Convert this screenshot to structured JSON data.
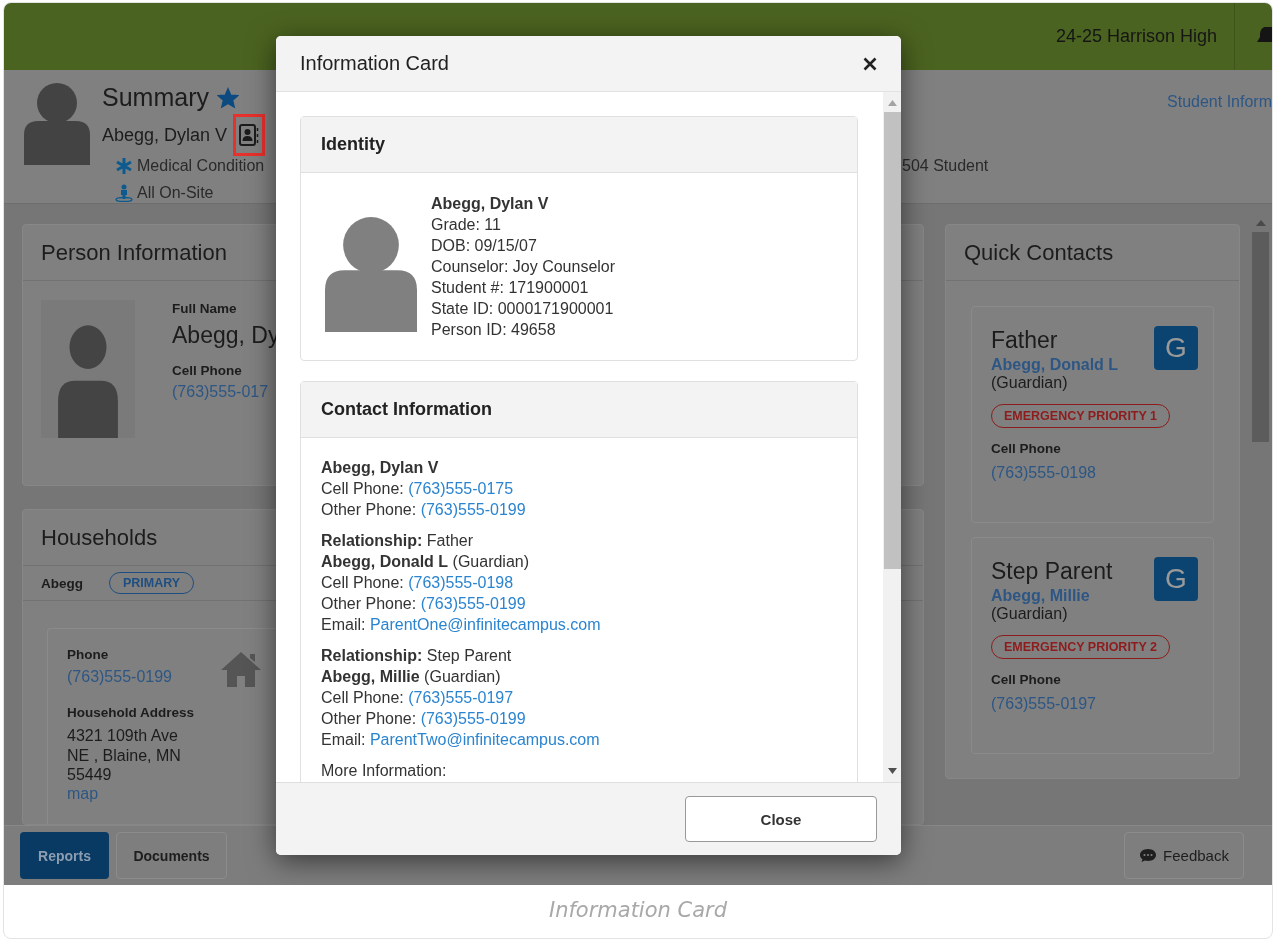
{
  "top_bar": {
    "school": "24-25 Harrison High"
  },
  "header": {
    "title": "Summary",
    "favorite": true,
    "student_name": "Abegg, Dylan V",
    "flags": [
      {
        "kind": "medical",
        "label": "Medical Condition"
      },
      {
        "kind": "plain",
        "label": "504 Student"
      }
    ],
    "location": "All On-Site",
    "link": "Student Inform"
  },
  "person_information": {
    "title": "Person Information",
    "fields": [
      {
        "label": "Full Name",
        "value": "Abegg, Dy",
        "kind": "large"
      },
      {
        "label": "Cell Phone",
        "value": "(763)555-017",
        "kind": "link"
      }
    ]
  },
  "households": {
    "title": "Households",
    "household": "Abegg",
    "badge": "PRIMARY",
    "phone_label": "Phone",
    "phone": "(763)555-0199",
    "address_label": "Household Address",
    "address": "4321 109th Ave NE , Blaine, MN 55449",
    "map_link": "map"
  },
  "quick_contacts": {
    "title": "Quick Contacts",
    "contacts": [
      {
        "relationship": "Father",
        "name": "Abegg, Donald L",
        "role": "(Guardian)",
        "badge": "G",
        "priority": "EMERGENCY PRIORITY 1",
        "phone_label": "Cell Phone",
        "phone": "(763)555-0198"
      },
      {
        "relationship": "Step Parent",
        "name": "Abegg, Millie",
        "role": "(Guardian)",
        "badge": "G",
        "priority": "EMERGENCY PRIORITY 2",
        "phone_label": "Cell Phone",
        "phone": "(763)555-0197"
      }
    ]
  },
  "bottom_bar": {
    "buttons": [
      {
        "label": "Reports",
        "kind": "primary"
      },
      {
        "label": "Documents",
        "kind": "default"
      }
    ],
    "feedback": "Feedback"
  },
  "modal": {
    "title": "Information Card",
    "identity": {
      "title": "Identity",
      "name": "Abegg, Dylan V",
      "lines": [
        "Grade: 11",
        "DOB: 09/15/07",
        "Counselor: Joy Counselor",
        "Student #: 171900001",
        "State ID: 0000171900001",
        "Person ID: 49658"
      ]
    },
    "contact": {
      "title": "Contact Information",
      "groups": [
        [
          {
            "kind": "name",
            "text": "Abegg, Dylan V"
          },
          {
            "kind": "link",
            "label": "Cell Phone:",
            "value": "(763)555-0175"
          },
          {
            "kind": "link",
            "label": "Other Phone:",
            "value": "(763)555-0199"
          }
        ],
        [
          {
            "kind": "rich",
            "text": "**Relationship:** Father"
          },
          {
            "kind": "rich",
            "text": "**Abegg, Donald L** (Guardian)"
          },
          {
            "kind": "link",
            "label": "Cell Phone:",
            "value": "(763)555-0198"
          },
          {
            "kind": "link",
            "label": "Other Phone:",
            "value": "(763)555-0199"
          },
          {
            "kind": "link",
            "label": "Email:",
            "value": "ParentOne@infinitecampus.com"
          }
        ],
        [
          {
            "kind": "rich",
            "text": "**Relationship:** Step Parent"
          },
          {
            "kind": "rich",
            "text": "**Abegg, Millie** (Guardian)"
          },
          {
            "kind": "link",
            "label": "Cell Phone:",
            "value": "(763)555-0197"
          },
          {
            "kind": "link",
            "label": "Other Phone:",
            "value": "(763)555-0199"
          },
          {
            "kind": "link",
            "label": "Email:",
            "value": "ParentTwo@infinitecampus.com"
          }
        ],
        [
          {
            "kind": "text",
            "text": "More Information:"
          }
        ]
      ]
    },
    "close_button": "Close"
  },
  "caption": "Information Card"
}
